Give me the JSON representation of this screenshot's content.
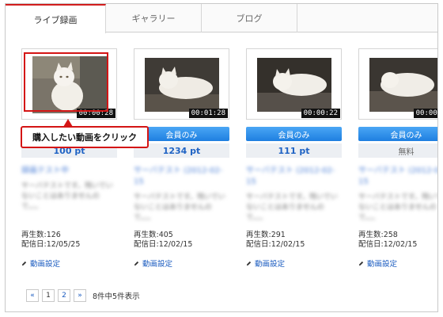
{
  "tabs": [
    {
      "label": "ライブ録画",
      "active": true
    },
    {
      "label": "ギャラリー",
      "active": false
    },
    {
      "label": "ブログ",
      "active": false
    }
  ],
  "callout": {
    "text": "購入したい動画をクリック",
    "color": "#d41515"
  },
  "member_button_label": "会員のみ",
  "setting_label": "動画設定",
  "cards": [
    {
      "duration": "00:00:28",
      "price": "100 pt",
      "views": "再生数:126",
      "date": "配信日:12/05/25",
      "title": "録画テスト中",
      "desc": "サーバテストです。残いでいないことはありませんので。。。"
    },
    {
      "duration": "00:01:28",
      "price": "1234 pt",
      "views": "再生数:405",
      "date": "配信日:12/02/15",
      "title": "サーバテスト (2012-02-15",
      "desc": "サーバテストです。残いでいないことはありませんので。。。"
    },
    {
      "duration": "00:00:22",
      "price": "111 pt",
      "views": "再生数:291",
      "date": "配信日:12/02/15",
      "title": "サーバテスト (2012-02-15",
      "desc": "サーバテストです。残いでいないことはありませんので。。。"
    },
    {
      "duration": "00:00:28",
      "price": "無料",
      "views": "再生数:258",
      "date": "配信日:12/02/15",
      "title": "サーバテスト (2012-02-15",
      "desc": "サーバテストです。残いでいないことはありませんので。。。"
    }
  ],
  "pagination": {
    "prev": "«",
    "pages": [
      "1",
      "2"
    ],
    "current": "1",
    "next": "»",
    "info": "8件中5件表示"
  }
}
